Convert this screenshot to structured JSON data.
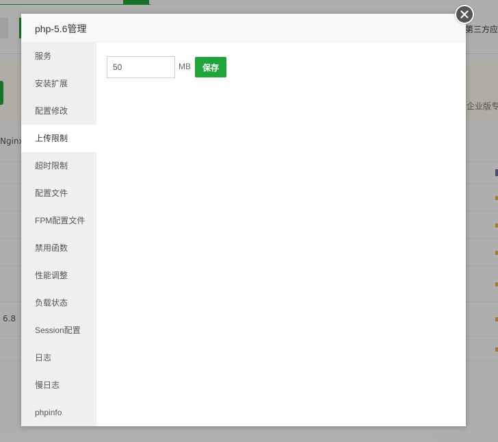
{
  "background": {
    "tab_right": "第三方应用",
    "banner_text": "企业版专",
    "nginx_label": "Nginx",
    "version_label": "6.8"
  },
  "modal": {
    "title": "php-5.6管理",
    "sidebar": {
      "items": [
        {
          "label": "服务"
        },
        {
          "label": "安装扩展"
        },
        {
          "label": "配置修改"
        },
        {
          "label": "上传限制",
          "active": true
        },
        {
          "label": "超时限制"
        },
        {
          "label": "配置文件"
        },
        {
          "label": "FPM配置文件"
        },
        {
          "label": "禁用函数"
        },
        {
          "label": "性能调整"
        },
        {
          "label": "负载状态"
        },
        {
          "label": "Session配置"
        },
        {
          "label": "日志"
        },
        {
          "label": "慢日志"
        },
        {
          "label": "phpinfo"
        }
      ]
    },
    "upload_limit": {
      "value": "50",
      "unit": "MB",
      "save_label": "保存"
    }
  },
  "icons": {
    "close": "close-icon"
  },
  "colors": {
    "accent": "#20a53a",
    "sidebar_bg": "#f0f0f0",
    "close_button": "#555555"
  }
}
